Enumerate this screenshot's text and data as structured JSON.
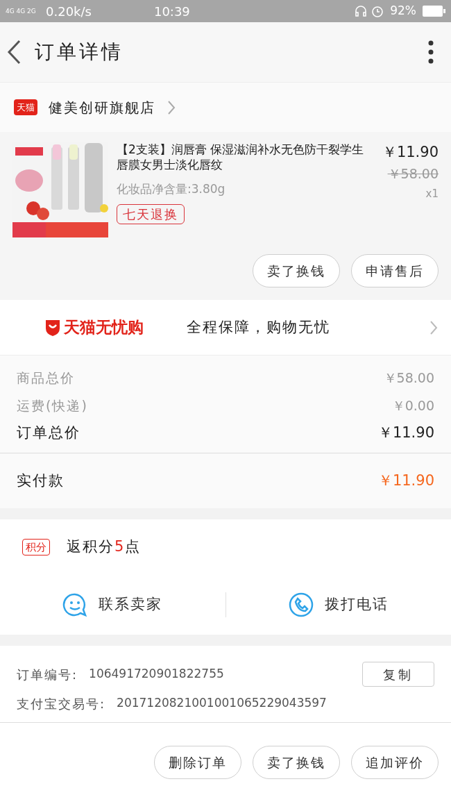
{
  "status_bar": {
    "network": "4G 4G 2G",
    "speed": "0.20k/s",
    "time": "10:39",
    "battery": "92%"
  },
  "header": {
    "title": "订单详情"
  },
  "store": {
    "badge": "天猫",
    "name": "健美创研旗舰店"
  },
  "product": {
    "title": "【2支装】润唇膏 保湿滋润补水无色防干裂学生唇膜女男士淡化唇纹",
    "spec": "化妆品净含量:3.80g",
    "tag": "七天退换",
    "price": "￥11.90",
    "original_price": "￥58.00",
    "quantity": "x1"
  },
  "product_actions": [
    "卖了换钱",
    "申请售后"
  ],
  "guarantee": {
    "brand": "天猫无忧购",
    "text": "全程保障，购物无忧"
  },
  "costs": [
    {
      "label": "商品总价",
      "value": "￥58.00",
      "kind": "minor"
    },
    {
      "label": "运费(快递)",
      "value": "￥0.00",
      "kind": "minor"
    },
    {
      "label": "订单总价",
      "value": "￥11.90",
      "kind": "major"
    }
  ],
  "paid": {
    "label": "实付款",
    "value": "￥11.90"
  },
  "points": {
    "badge": "积分",
    "prefix": "返积分",
    "count": "5",
    "suffix": "点"
  },
  "contact": [
    {
      "label": "联系卖家",
      "kind": "chat"
    },
    {
      "label": "拨打电话",
      "kind": "phone"
    }
  ],
  "order_info": [
    {
      "label": "订单编号:",
      "value": "106491720901822755"
    },
    {
      "label": "支付宝交易号:",
      "value": "2017120821001001065229043597"
    }
  ],
  "copy_button": "复制",
  "bottom_actions": [
    "删除订单",
    "卖了换钱",
    "追加评价"
  ]
}
